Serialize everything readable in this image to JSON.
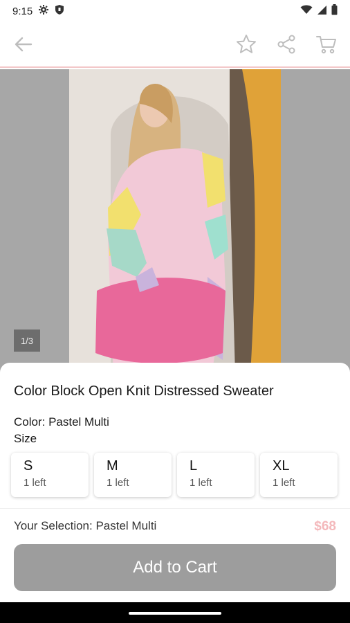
{
  "status_bar": {
    "time": "9:15"
  },
  "product": {
    "image_counter": "1/3",
    "title": "Color Block Open Knit Distressed Sweater",
    "color_line": "Color: Pastel Multi",
    "size_heading": "Size",
    "sizes": [
      {
        "label": "S",
        "stock": "1 left"
      },
      {
        "label": "M",
        "stock": "1 left"
      },
      {
        "label": "L",
        "stock": "1 left"
      },
      {
        "label": "XL",
        "stock": "1 left"
      }
    ],
    "selection": "Your Selection: Pastel Multi",
    "price": "$68",
    "add_to_cart": "Add to Cart"
  },
  "icons": {
    "back": "arrow-left-icon",
    "favorite": "star-icon",
    "share": "share-icon",
    "cart": "cart-icon"
  },
  "colors": {
    "price": "#f4b8bb",
    "button": "#9d9d9d",
    "app_bar_border": "#f3c7c8"
  }
}
